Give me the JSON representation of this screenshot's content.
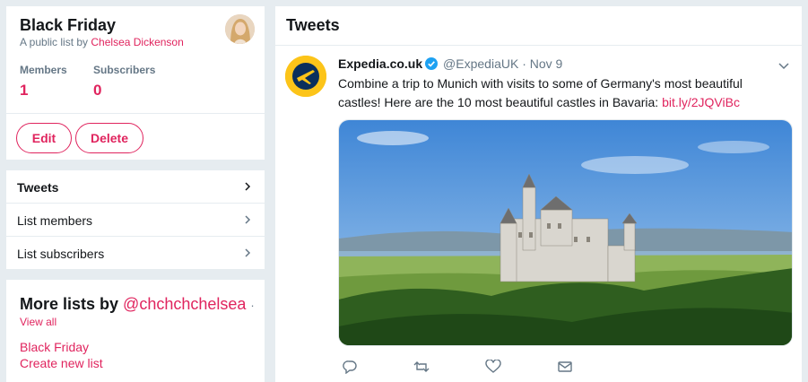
{
  "list": {
    "title": "Black Friday",
    "byline_prefix": "A public list by",
    "owner": "Chelsea Dickenson",
    "stats": [
      {
        "label": "Members",
        "value": "1"
      },
      {
        "label": "Subscribers",
        "value": "0"
      }
    ],
    "edit_label": "Edit",
    "delete_label": "Delete"
  },
  "nav": {
    "items": [
      {
        "label": "Tweets"
      },
      {
        "label": "List members"
      },
      {
        "label": "List subscribers"
      }
    ]
  },
  "more_lists": {
    "heading": "More lists by",
    "handle": "@chchchchelsea",
    "separator": "·",
    "view_all": "View all",
    "links": [
      "Black Friday",
      "Create new list"
    ]
  },
  "tweets": {
    "title": "Tweets",
    "tweet": {
      "name": "Expedia.co.uk",
      "handle": "@ExpediaUK",
      "separator": "·",
      "date": "Nov 9",
      "text": "Combine a trip to Munich with visits to some of Germany's most beautiful castles! Here are the 10 most beautiful castles in Bavaria:",
      "url": "bit.ly/2JQViBc"
    }
  },
  "colors": {
    "accent": "#e0245e",
    "verified": "#1da1f2",
    "background": "#e6ecf0",
    "expedia_yellow": "#fcc419"
  },
  "icons": [
    "avatar-photo",
    "expedia-logo-icon",
    "verified-badge-icon",
    "chevron-down-icon",
    "chevron-right-icon",
    "reply-icon",
    "retweet-icon",
    "like-icon",
    "message-icon"
  ]
}
